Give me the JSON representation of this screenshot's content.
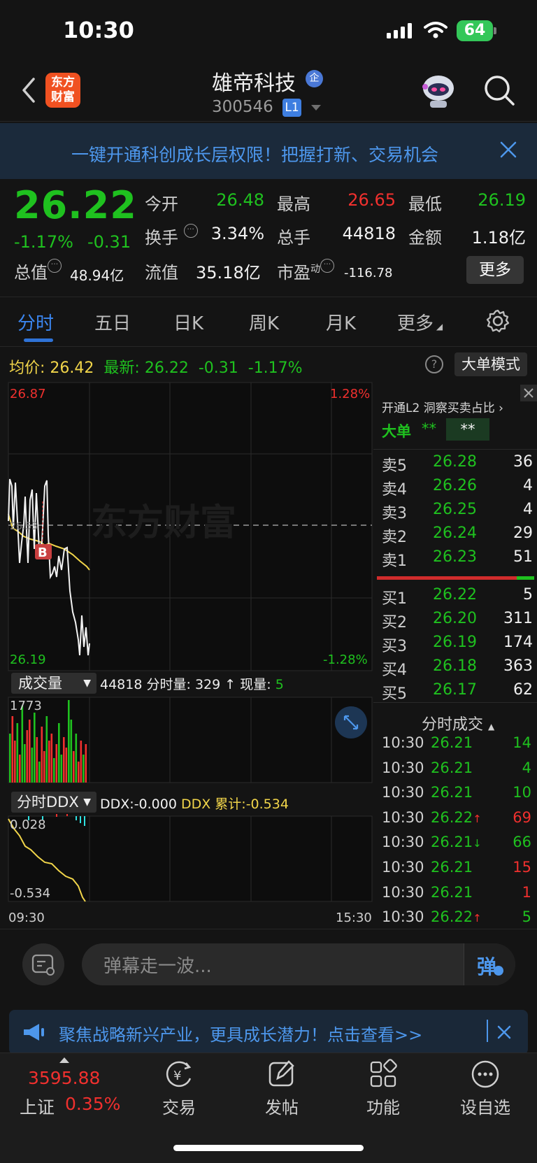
{
  "status_bar": {
    "time": "10:30",
    "battery": "64"
  },
  "header": {
    "stock_name": "雄帝科技",
    "qi_badge": "企",
    "stock_code": "300546",
    "level": "L1",
    "logo_line1": "东方",
    "logo_line2": "财富"
  },
  "banner": {
    "text": "一键开通科创成长层权限！把握打新、交易机会"
  },
  "quote": {
    "price": "26.22",
    "pct": "-1.17%",
    "change": "-0.31",
    "open_label": "今开",
    "open": "26.48",
    "high_label": "最高",
    "high": "26.65",
    "low_label": "最低",
    "low": "26.19",
    "turnover_label": "换手",
    "turnover": "3.34%",
    "volume_label": "总手",
    "volume": "44818",
    "amount_label": "金额",
    "amount": "1.18亿",
    "mktcap_label": "总值",
    "mktcap": "48.94亿",
    "float_label": "流值",
    "float": "35.18亿",
    "pe_label": "市盈",
    "pe_sup": "动",
    "pe": "-116.78",
    "more": "更多"
  },
  "tabs": [
    "分时",
    "五日",
    "日K",
    "周K",
    "月K",
    "更多"
  ],
  "legend": {
    "avg_label": "均价:",
    "avg": "26.42",
    "latest_label": "最新:",
    "latest": "26.22",
    "latest_chg": "-0.31",
    "latest_pct": "-1.17%",
    "big_order_mode": "大单模式"
  },
  "chart_labels": {
    "top_price": "26.87",
    "top_pct": "1.28%",
    "bottom_price": "26.19",
    "bottom_pct": "-1.28%",
    "ref_price": "26.53",
    "watermark": "东方财富",
    "vol_max": "1773",
    "ddx_top": "0.028",
    "ddx_bottom": "-0.534",
    "time_start": "09:30",
    "time_end": "15:30",
    "b_marker": "B"
  },
  "volume_bar": {
    "selector": "成交量",
    "total": "44818",
    "minute_label": "分时量:",
    "minute": "329",
    "now_label": "现量:",
    "now": "5"
  },
  "ddx_bar": {
    "selector": "分时DDX",
    "ddx_label": "DDX:",
    "ddx": "-0.000",
    "cum_label": "DDX 累计:",
    "cum": "-0.534"
  },
  "side_panel": {
    "l2_promo": "开通L2 洞察买卖占比",
    "big_order_label": "大单",
    "big_order_v1": "**",
    "big_order_v2": "**",
    "sell": [
      {
        "label": "卖5",
        "price": "26.28",
        "qty": "36"
      },
      {
        "label": "卖4",
        "price": "26.26",
        "qty": "4"
      },
      {
        "label": "卖3",
        "price": "26.25",
        "qty": "4"
      },
      {
        "label": "卖2",
        "price": "26.24",
        "qty": "29"
      },
      {
        "label": "卖1",
        "price": "26.23",
        "qty": "51"
      }
    ],
    "buy": [
      {
        "label": "买1",
        "price": "26.22",
        "qty": "5"
      },
      {
        "label": "买2",
        "price": "26.20",
        "qty": "311"
      },
      {
        "label": "买3",
        "price": "26.19",
        "qty": "174"
      },
      {
        "label": "买4",
        "price": "26.18",
        "qty": "363"
      },
      {
        "label": "买5",
        "price": "26.17",
        "qty": "62"
      }
    ],
    "ticks_title": "分时成交",
    "ticks": [
      {
        "time": "10:30",
        "price": "26.21",
        "qty": "14",
        "dir": "",
        "color": "green"
      },
      {
        "time": "10:30",
        "price": "26.21",
        "qty": "4",
        "dir": "",
        "color": "green"
      },
      {
        "time": "10:30",
        "price": "26.21",
        "qty": "10",
        "dir": "",
        "color": "green"
      },
      {
        "time": "10:30",
        "price": "26.22",
        "qty": "69",
        "dir": "↑",
        "color": "red"
      },
      {
        "time": "10:30",
        "price": "26.21",
        "qty": "66",
        "dir": "↓",
        "color": "green"
      },
      {
        "time": "10:30",
        "price": "26.21",
        "qty": "15",
        "dir": "",
        "color": "red"
      },
      {
        "time": "10:30",
        "price": "26.21",
        "qty": "1",
        "dir": "",
        "color": "red"
      },
      {
        "time": "10:30",
        "price": "26.22",
        "qty": "5",
        "dir": "↑",
        "color": "green"
      }
    ]
  },
  "comment": {
    "placeholder": "弹幕走一波...",
    "danmu": "弹"
  },
  "promo": {
    "text": "聚焦战略新兴产业，更具成长潜力！点击查看>>"
  },
  "bottom_nav": {
    "index_price": "3595.88",
    "index_name": "上证",
    "index_pct": "0.35%",
    "items": [
      "交易",
      "发帖",
      "功能",
      "设自选"
    ]
  },
  "colors": {
    "up": "#f0302e",
    "down": "#1fc11f",
    "avg_line": "#f1d54a",
    "accent": "#2f72d6"
  }
}
